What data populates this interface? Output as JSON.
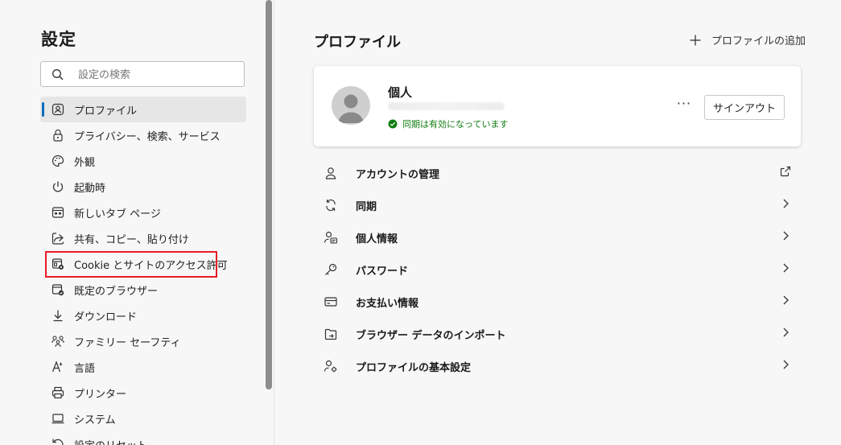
{
  "sidebar": {
    "title": "設定",
    "search": {
      "placeholder": "設定の検索",
      "value": ""
    },
    "items": [
      {
        "label": "プロファイル",
        "icon": "profile-icon",
        "active": true
      },
      {
        "label": "プライバシー、検索、サービス",
        "icon": "lock-icon"
      },
      {
        "label": "外観",
        "icon": "palette-icon"
      },
      {
        "label": "起動時",
        "icon": "power-icon"
      },
      {
        "label": "新しいタブ ページ",
        "icon": "new-tab-icon"
      },
      {
        "label": "共有、コピー、貼り付け",
        "icon": "share-icon"
      },
      {
        "label": "Cookie とサイトのアクセス許可",
        "icon": "site-permissions-icon",
        "highlighted": true
      },
      {
        "label": "既定のブラウザー",
        "icon": "default-browser-icon"
      },
      {
        "label": "ダウンロード",
        "icon": "download-icon"
      },
      {
        "label": "ファミリー セーフティ",
        "icon": "family-icon"
      },
      {
        "label": "言語",
        "icon": "language-icon"
      },
      {
        "label": "プリンター",
        "icon": "printer-icon"
      },
      {
        "label": "システム",
        "icon": "system-icon"
      },
      {
        "label": "設定のリセット",
        "icon": "reset-icon"
      }
    ]
  },
  "main": {
    "title": "プロファイル",
    "add_profile_label": "プロファイルの追加",
    "profile": {
      "name": "個人",
      "sync_status": "同期は有効になっています",
      "more_label": "···",
      "signout_label": "サインアウト"
    },
    "rows": [
      {
        "label": "アカウントの管理",
        "icon": "account-icon",
        "trail": "external-link-icon"
      },
      {
        "label": "同期",
        "icon": "sync-icon",
        "trail": "chevron-right-icon"
      },
      {
        "label": "個人情報",
        "icon": "personal-info-icon",
        "trail": "chevron-right-icon"
      },
      {
        "label": "パスワード",
        "icon": "key-icon",
        "trail": "chevron-right-icon"
      },
      {
        "label": "お支払い情報",
        "icon": "card-icon",
        "trail": "chevron-right-icon"
      },
      {
        "label": "ブラウザー データのインポート",
        "icon": "import-icon",
        "trail": "chevron-right-icon"
      },
      {
        "label": "プロファイルの基本設定",
        "icon": "profile-settings-icon",
        "trail": "chevron-right-icon"
      }
    ]
  },
  "colors": {
    "accent": "#0f6cbd",
    "highlight_border": "#e81c24",
    "sync_green": "#107c10"
  }
}
